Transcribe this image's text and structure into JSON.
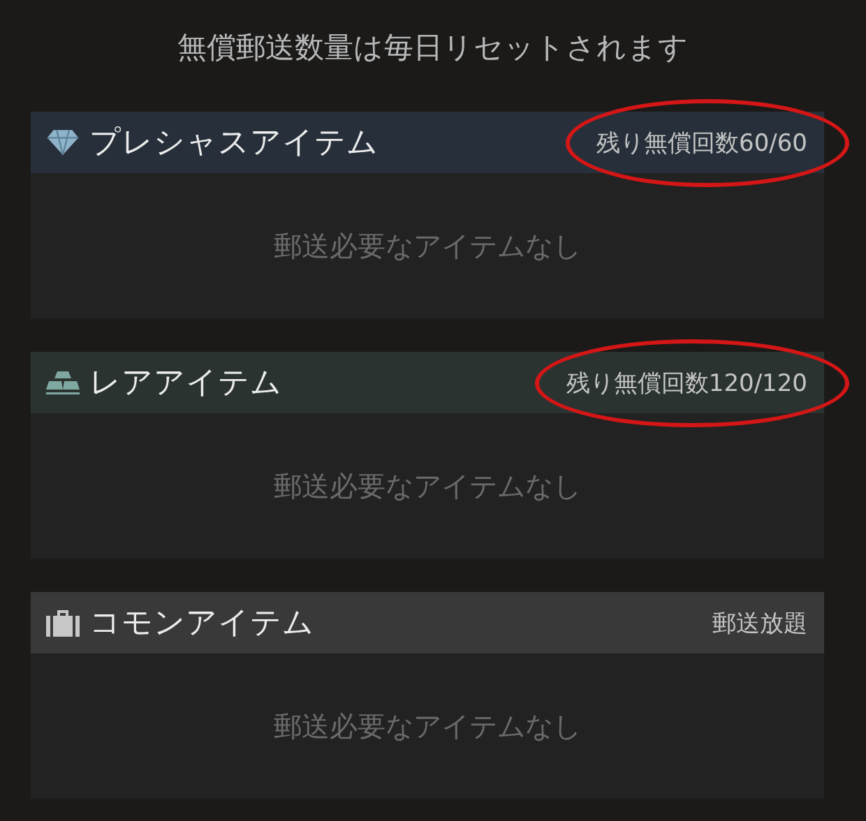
{
  "notice": "無償郵送数量は毎日リセットされます",
  "sections": [
    {
      "kind": "precious",
      "title": "プレシャスアイテム",
      "quota": "残り無償回数60/60",
      "circled": true,
      "empty_text": "郵送必要なアイテムなし"
    },
    {
      "kind": "rare",
      "title": "レアアイテム",
      "quota": "残り無償回数120/120",
      "circled": true,
      "empty_text": "郵送必要なアイテムなし"
    },
    {
      "kind": "common",
      "title": "コモンアイテム",
      "quota": "郵送放題",
      "circled": false,
      "empty_text": "郵送必要なアイテムなし"
    }
  ]
}
